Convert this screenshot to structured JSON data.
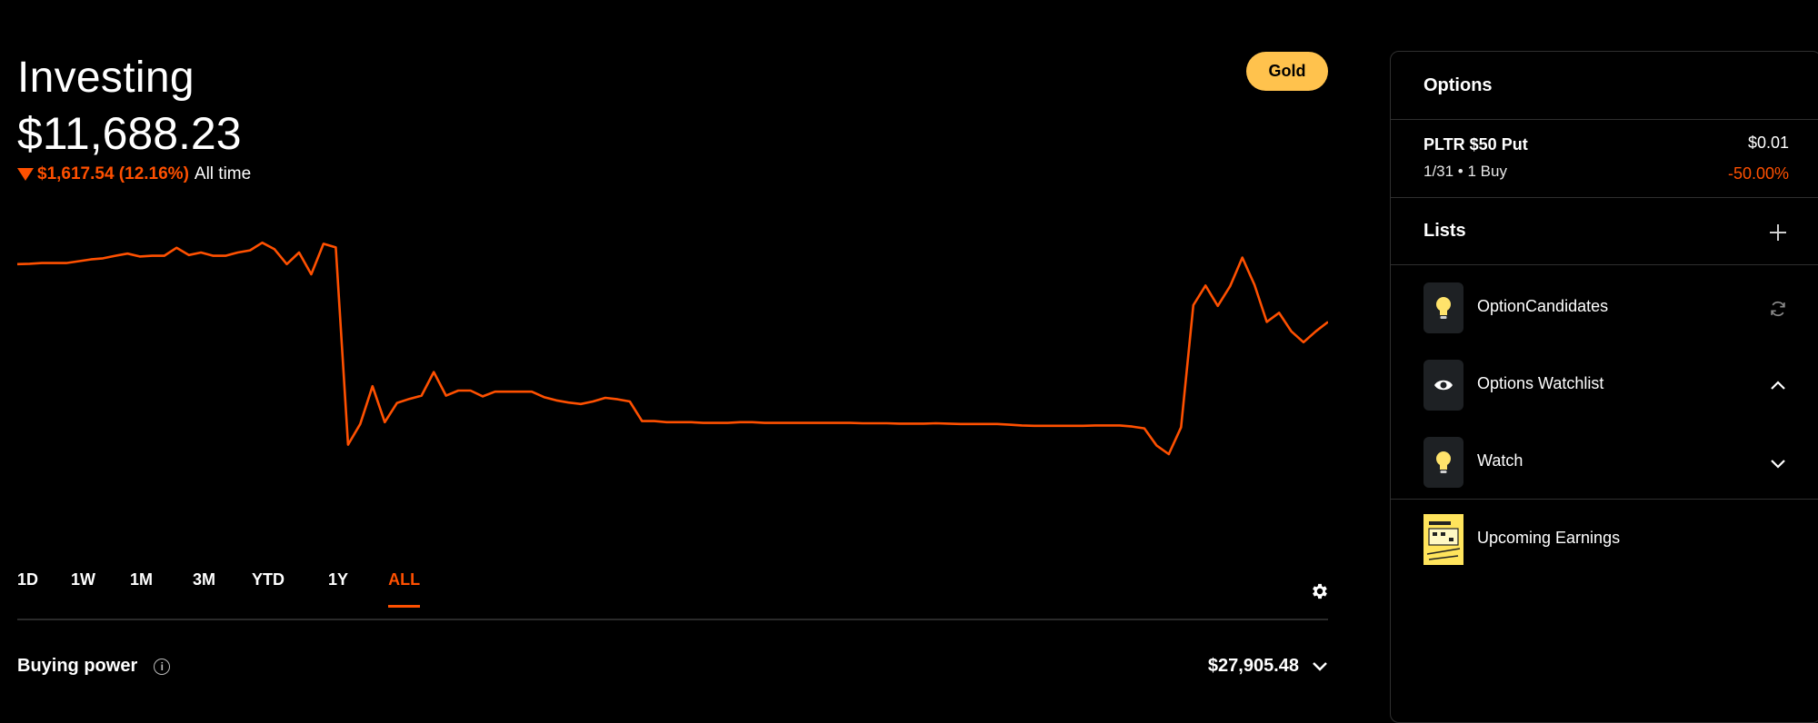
{
  "header": {
    "title": "Investing",
    "portfolio_value": "$11,688.23",
    "change_amount": "$1,617.54 (12.16%)",
    "change_period": "All time",
    "change_direction": "down",
    "badge": "Gold"
  },
  "colors": {
    "accent_down": "#ff5000",
    "gold": "#ffc24d",
    "background": "#000000"
  },
  "ranges": [
    {
      "label": "1D"
    },
    {
      "label": "1W"
    },
    {
      "label": "1M"
    },
    {
      "label": "3M"
    },
    {
      "label": "YTD"
    },
    {
      "label": "1Y"
    },
    {
      "label": "ALL",
      "active": true
    }
  ],
  "buying_power": {
    "label": "Buying power",
    "value": "$27,905.48"
  },
  "sidebar": {
    "options_title": "Options",
    "option": {
      "name": "PLTR $50 Put",
      "subtitle": "1/31 • 1 Buy",
      "price": "$0.01",
      "change": "-50.00%"
    },
    "lists_title": "Lists",
    "lists": [
      {
        "label": "OptionCandidates",
        "icon": "lightbulb-icon",
        "action": "refresh-icon"
      },
      {
        "label": "Options Watchlist",
        "icon": "eye-icon",
        "action": "chevron-up-icon"
      },
      {
        "label": "Watch",
        "icon": "lightbulb-icon",
        "action": "chevron-down-icon"
      },
      {
        "label": "Upcoming Earnings",
        "icon": "earnings-calendar-icon",
        "action": ""
      }
    ]
  },
  "chart_data": {
    "type": "line",
    "title": "",
    "xlabel": "",
    "ylabel": "",
    "x_axis_shown": false,
    "y_axis_shown": false,
    "grid": false,
    "ylim": [
      0,
      100
    ],
    "series": [
      {
        "color": "#ff5000",
        "values": [
          77.3,
          77.4,
          77.6,
          77.6,
          77.6,
          78.1,
          78.6,
          78.9,
          79.6,
          80.2,
          79.4,
          79.6,
          79.6,
          81.8,
          79.8,
          80.5,
          79.6,
          79.6,
          80.5,
          81.1,
          83.2,
          81.4,
          77.3,
          80.5,
          74.5,
          82.9,
          81.9,
          27.6,
          33.3,
          43.7,
          33.8,
          39.1,
          40.2,
          41.1,
          47.6,
          41.1,
          42.5,
          42.5,
          40.9,
          42.2,
          42.2,
          42.2,
          42.2,
          40.7,
          39.8,
          39.2,
          38.8,
          39.5,
          40.5,
          40.1,
          39.5,
          34.1,
          34.1,
          33.8,
          33.8,
          33.8,
          33.6,
          33.6,
          33.6,
          33.8,
          33.8,
          33.6,
          33.6,
          33.6,
          33.6,
          33.6,
          33.6,
          33.6,
          33.6,
          33.5,
          33.5,
          33.5,
          33.4,
          33.4,
          33.4,
          33.5,
          33.4,
          33.3,
          33.3,
          33.3,
          33.3,
          33.1,
          32.9,
          32.8,
          32.8,
          32.8,
          32.8,
          32.8,
          32.9,
          32.9,
          32.9,
          32.6,
          32.1,
          27.4,
          25.0,
          32.4,
          66.0,
          71.4,
          65.8,
          71.2,
          79.1,
          71.6,
          61.4,
          63.9,
          58.8,
          55.8,
          58.8,
          61.4
        ]
      }
    ]
  }
}
